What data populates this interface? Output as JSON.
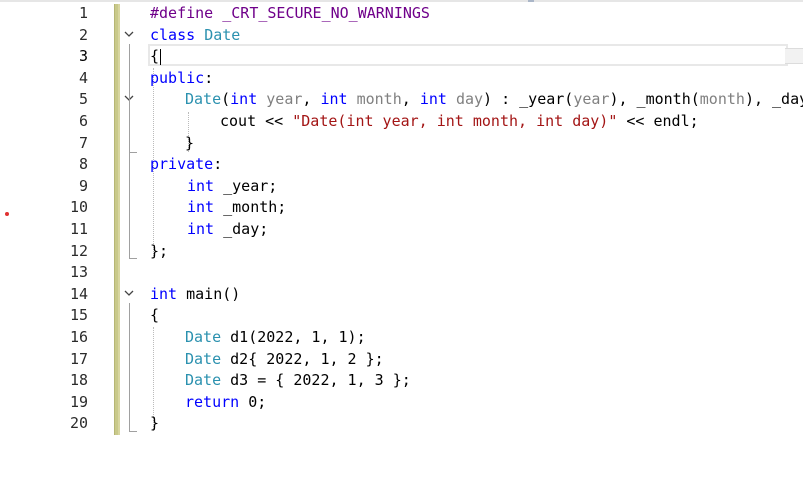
{
  "editor": {
    "line_numbers": [
      "1",
      "2",
      "3",
      "4",
      "5",
      "6",
      "7",
      "8",
      "9",
      "10",
      "11",
      "12",
      "13",
      "14",
      "15",
      "16",
      "17",
      "18",
      "19",
      "20"
    ],
    "current_line": "3",
    "lines": {
      "l1": {
        "pp": "#define",
        "rest": " ",
        "macro": "_CRT_SECURE_NO_WARNINGS"
      },
      "l2": {
        "kw": "class",
        "sp": " ",
        "type": "Date"
      },
      "l3": {
        "brace": "{"
      },
      "l4": {
        "kw": "public",
        "colon": ":"
      },
      "l5": {
        "type": "Date",
        "p1": "(",
        "kw1": "int",
        "sp1": " ",
        "param1": "year",
        "c1": ", ",
        "kw2": "int",
        "sp2": " ",
        "param2": "month",
        "c2": ", ",
        "kw3": "int",
        "sp3": " ",
        "param3": "day",
        "mid": ") : _year(",
        "param4": "year",
        "c3": "), _month(",
        "param5": "month",
        "c4": "), _day"
      },
      "l6": {
        "pre": "cout << ",
        "str": "\"Date(int year, int month, int day)\"",
        "post": " << endl;"
      },
      "l7": {
        "brace": "}"
      },
      "l8": {
        "kw": "private",
        "colon": ":"
      },
      "l9": {
        "kw": "int",
        "rest": " _year;"
      },
      "l10": {
        "kw": "int",
        "rest": " _month;"
      },
      "l11": {
        "kw": "int",
        "rest": " _day;"
      },
      "l12": {
        "rest": "};"
      },
      "l14": {
        "kw": "int",
        "rest": " main()"
      },
      "l15": {
        "brace": "{"
      },
      "l16": {
        "type": "Date",
        "rest": " d1(2022, 1, 1);"
      },
      "l17": {
        "type": "Date",
        "rest": " d2{ 2022, 1, 2 };"
      },
      "l18": {
        "type": "Date",
        "rest": " d3 = { 2022, 1, 3 };"
      },
      "l19": {
        "kw": "return",
        "rest": " 0;"
      },
      "l20": {
        "brace": "}"
      }
    }
  },
  "colors": {
    "keyword": "#0000ff",
    "type": "#2b91af",
    "preprocessor": "#6f008a",
    "string": "#a31515",
    "parameter": "#808080"
  },
  "icons": {
    "fold": "chevron-down-icon"
  }
}
